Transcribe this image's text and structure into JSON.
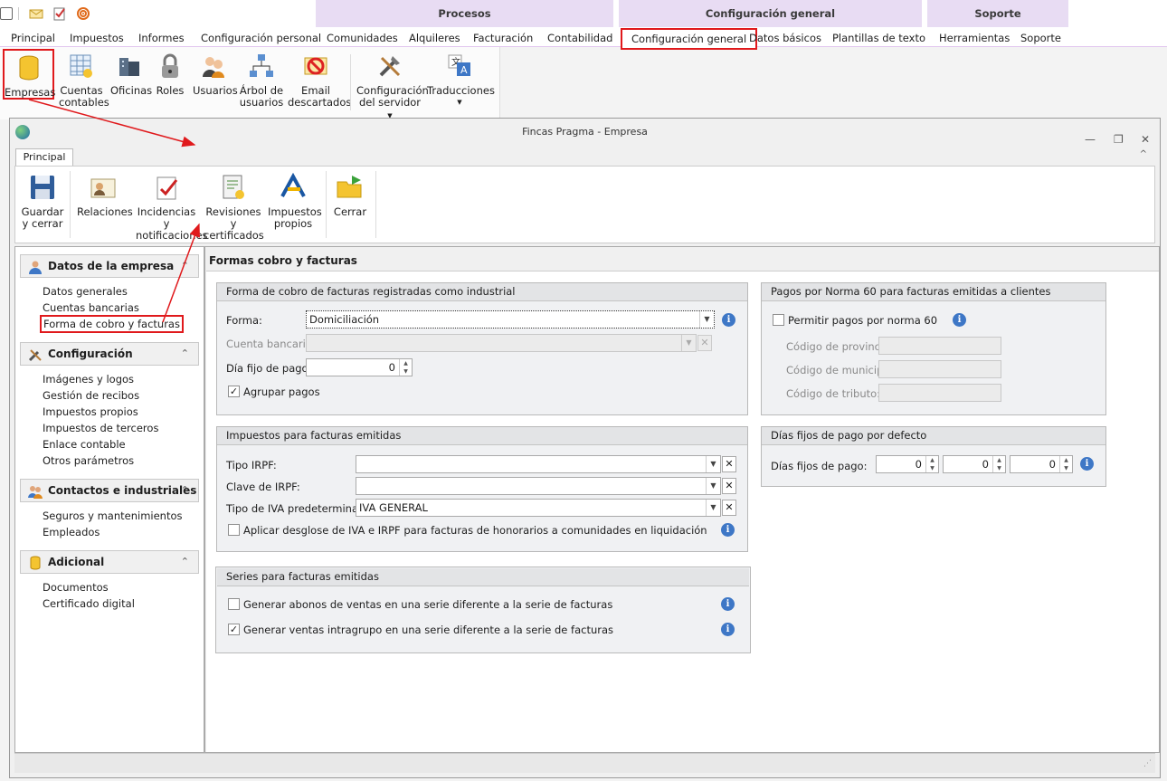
{
  "topbar": {
    "groups": [
      {
        "label": "Procesos"
      },
      {
        "label": "Configuración general"
      },
      {
        "label": "Soporte"
      }
    ],
    "menu": [
      "Principal",
      "Impuestos",
      "Informes",
      "Configuración personal",
      "Comunidades",
      "Alquileres",
      "Facturación",
      "Contabilidad",
      "Configuración general",
      "Datos básicos",
      "Plantillas de texto",
      "Herramientas",
      "Soporte"
    ],
    "active_menu": "Configuración general"
  },
  "ribbon": {
    "buttons": [
      "Empresas",
      "Cuentas contables",
      "Oficinas",
      "Roles",
      "Usuarios",
      "Árbol de usuarios",
      "Email descartados",
      "Configuración del servidor",
      "Traducciones"
    ],
    "group_label": "Configuración general"
  },
  "window": {
    "title": "Fincas Pragma - Empresa",
    "tab": "Principal",
    "buttons": [
      "Guardar y cerrar",
      "Relaciones",
      "Incidencias y notificaciones",
      "Revisiones y certificados",
      "Impuestos propios",
      "Cerrar"
    ]
  },
  "sidebar": {
    "sections": [
      {
        "title": "Datos de la empresa",
        "items": [
          "Datos generales",
          "Cuentas bancarias",
          "Forma de cobro y facturas"
        ]
      },
      {
        "title": "Configuración",
        "items": [
          "Imágenes y logos",
          "Gestión de recibos",
          "Impuestos propios",
          "Impuestos de terceros",
          "Enlace contable",
          "Otros parámetros"
        ]
      },
      {
        "title": "Contactos e industriales",
        "items": [
          "Seguros y mantenimientos",
          "Empleados"
        ]
      },
      {
        "title": "Adicional",
        "items": [
          "Documentos",
          "Certificado digital"
        ]
      }
    ]
  },
  "main": {
    "title": "Formas cobro y facturas",
    "cobro": {
      "header": "Forma de cobro de facturas registradas como industrial",
      "forma_label": "Forma:",
      "forma_value": "Domiciliación",
      "cuenta_label": "Cuenta bancaria:",
      "dia_label": "Día fijo de pago:",
      "dia_value": "0",
      "agrupar_label": "Agrupar pagos",
      "agrupar_checked": true
    },
    "impuestos": {
      "header": "Impuestos para facturas emitidas",
      "tipo_irpf_label": "Tipo IRPF:",
      "clave_irpf_label": "Clave de IRPF:",
      "iva_label": "Tipo de IVA predeterminado:",
      "iva_value": "IVA GENERAL",
      "desglose_label": "Aplicar desglose de IVA e IRPF para facturas de honorarios a comunidades en liquidación",
      "desglose_checked": false
    },
    "series": {
      "header": "Series para facturas emitidas",
      "abonos_label": "Generar abonos de ventas en una serie diferente a la serie de facturas",
      "abonos_checked": false,
      "intragrupo_label": "Generar ventas intragrupo en una serie diferente a la serie de facturas",
      "intragrupo_checked": true
    },
    "norma60": {
      "header": "Pagos por Norma 60 para facturas emitidas a clientes",
      "permitir_label": "Permitir pagos por norma 60",
      "permitir_checked": false,
      "provincia_label": "Código de provincia:",
      "municipio_label": "Código de municipio:",
      "tributo_label": "Código de tributo:"
    },
    "dias": {
      "header": "Días fijos de pago por defecto",
      "label": "Días fijos de pago:",
      "values": [
        "0",
        "0",
        "0"
      ]
    }
  },
  "colors": {
    "highlight": "#e0191c",
    "group_bg": "#e8dcf3",
    "info": "#3e77c6"
  }
}
